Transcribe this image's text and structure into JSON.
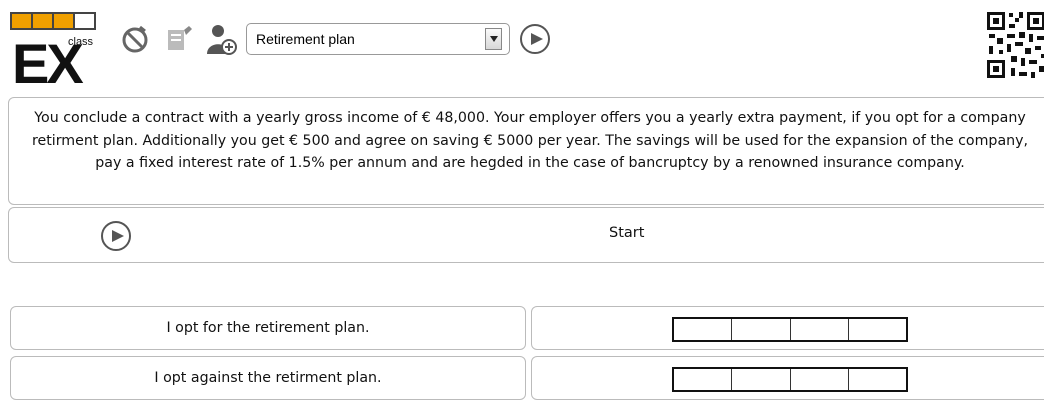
{
  "header": {
    "logo_text": "EX",
    "logo_class": "class",
    "logo_progress_filled": 3,
    "logo_progress_total": 4,
    "icons": [
      "no-timer-icon",
      "edit-icon",
      "add-user-icon"
    ],
    "select_value": "Retirement plan"
  },
  "task": {
    "text": "You conclude a contract with a yearly gross income of € 48,000. Your employer offers you a yearly extra payment, if you opt for a company retirment plan. Additionally you get € 500 and agree on saving € 5000 per year. The savings will be used for the expansion of the company, pay a fixed interest rate of 1.5% per annum and are hegded in the case of bancruptcy by a renowned insurance company."
  },
  "start": {
    "label": "Start"
  },
  "options": [
    {
      "label": "I opt for the retirement plan."
    },
    {
      "label": "I opt against the retirment plan."
    }
  ],
  "colors": {
    "accent": "#f0a000",
    "border": "#bbbbbb"
  }
}
